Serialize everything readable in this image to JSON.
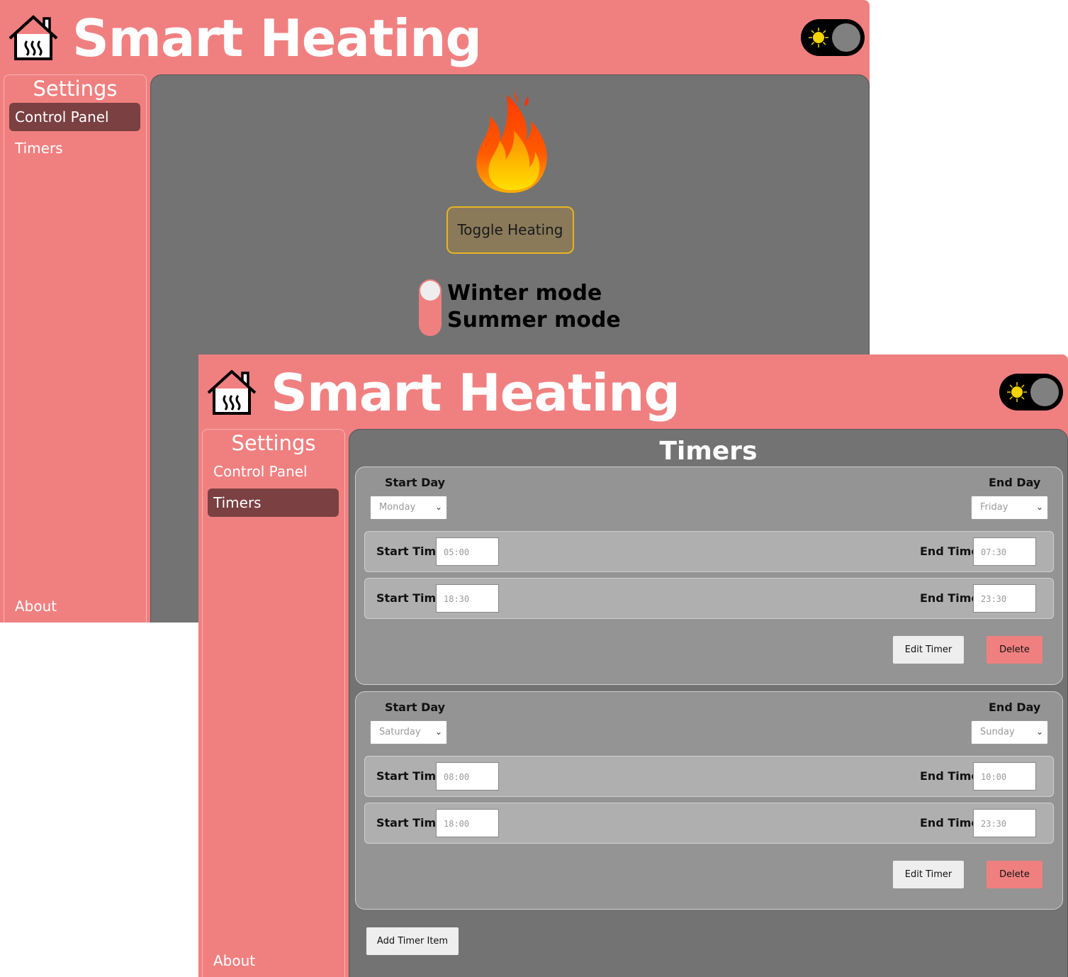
{
  "app": {
    "title": "Smart Heating",
    "accent_color": "#f08080",
    "content_bg": "#737373"
  },
  "control_panel_window": {
    "sidebar": {
      "title": "Settings",
      "items": [
        {
          "label": "Control Panel",
          "active": true
        },
        {
          "label": "Timers",
          "active": false
        }
      ],
      "about_label": "About"
    },
    "main": {
      "flame_icon": "flame-icon",
      "toggle_heating_label": "Toggle Heating",
      "mode_options": [
        "Winter mode",
        "Summer mode"
      ]
    }
  },
  "timers_window": {
    "sidebar": {
      "title": "Settings",
      "items": [
        {
          "label": "Control Panel",
          "active": false
        },
        {
          "label": "Timers",
          "active": true
        }
      ],
      "about_label": "About"
    },
    "main": {
      "title": "Timers",
      "start_day_label": "Start Day",
      "end_day_label": "End Day",
      "start_time_label": "Start Time",
      "end_time_label": "End Time",
      "edit_label": "Edit Timer",
      "delete_label": "Delete",
      "add_label": "Add Timer Item",
      "timers": [
        {
          "start_day": "Monday",
          "end_day": "Friday",
          "periods": [
            {
              "start": "05:00",
              "end": "07:30"
            },
            {
              "start": "18:30",
              "end": "23:30"
            }
          ]
        },
        {
          "start_day": "Saturday",
          "end_day": "Sunday",
          "periods": [
            {
              "start": "08:00",
              "end": "10:00"
            },
            {
              "start": "18:00",
              "end": "23:30"
            }
          ]
        }
      ]
    }
  }
}
